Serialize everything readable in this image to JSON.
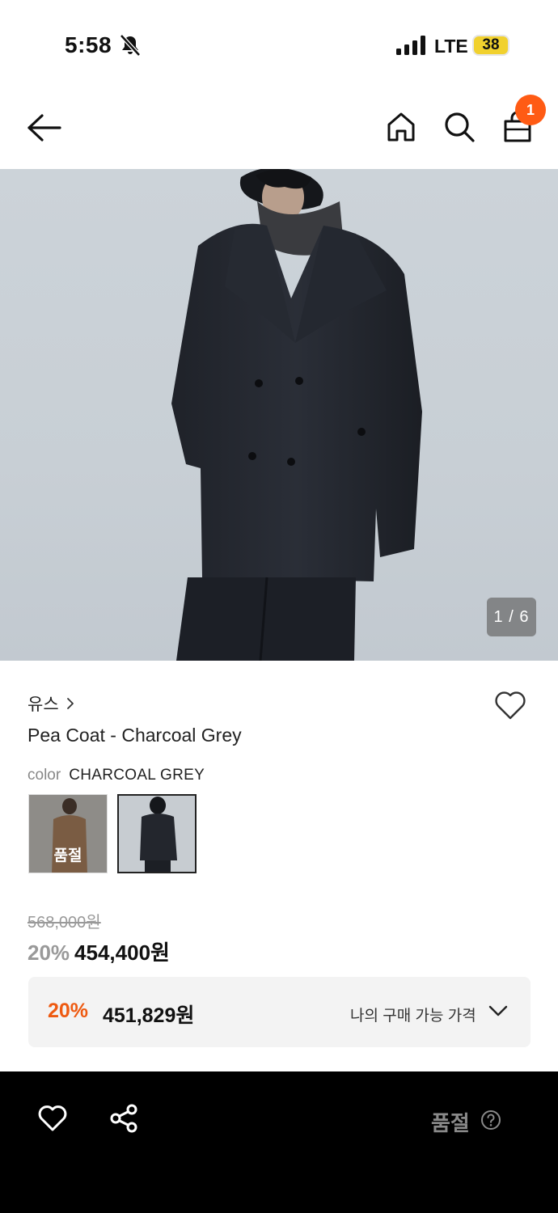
{
  "status_bar": {
    "time": "5:58",
    "network": "LTE",
    "battery": "38",
    "icons": [
      "bell-off-icon",
      "signal-icon"
    ]
  },
  "nav": {
    "cart_count": "1",
    "icons": [
      "back-arrow-icon",
      "home-icon",
      "search-icon",
      "shopping-bag-icon"
    ]
  },
  "gallery": {
    "counter": "1 / 6",
    "current": 1,
    "total": 6
  },
  "product": {
    "brand": "유스",
    "name": "Pea Coat - Charcoal Grey",
    "color_label": "color",
    "color_value": "CHARCOAL GREY",
    "swatches": [
      {
        "name": "brown",
        "label": "품절",
        "soldout": true
      },
      {
        "name": "charcoal-grey",
        "label": "",
        "selected": true
      }
    ],
    "original_price": "568,000원",
    "discount": "20%",
    "price": "454,400원"
  },
  "my_price": {
    "discount": "20%",
    "price": "451,829원",
    "label": "나의 구매 가능 가격"
  },
  "bottom_bar": {
    "status": "품절",
    "icons": [
      "heart-icon",
      "share-icon",
      "help-icon"
    ]
  },
  "colors": {
    "accent_orange": "#ff5b14",
    "discount_orange": "#ee5a11",
    "bottom_bar": "#000000",
    "battery": "#f1d12e"
  }
}
